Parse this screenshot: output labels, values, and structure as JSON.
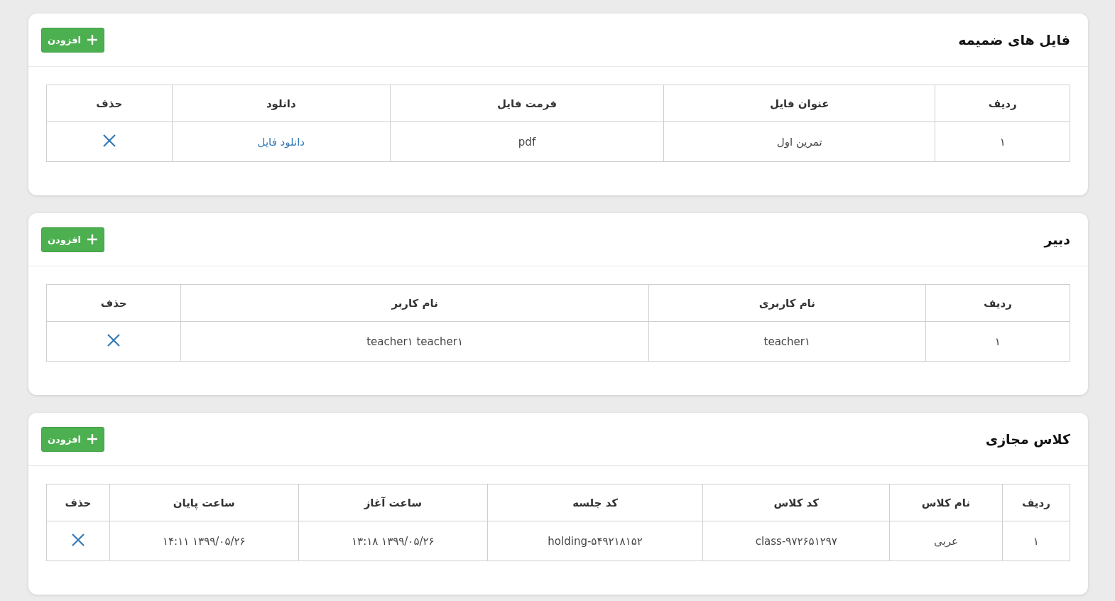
{
  "sections": [
    {
      "title": "فایل های ضمیمه",
      "add_button": "افزودن",
      "table": {
        "columns": [
          "ردیف",
          "عنوان فایل",
          "فرمت فایل",
          "دانلود",
          "حذف"
        ],
        "rows": [
          {
            "cells": [
              {
                "kind": "text",
                "text": "۱"
              },
              {
                "kind": "text",
                "text": "تمرین اول"
              },
              {
                "kind": "text",
                "text": "pdf"
              },
              {
                "kind": "link",
                "text": "دانلود فایل"
              },
              {
                "kind": "delete"
              }
            ]
          }
        ]
      }
    },
    {
      "title": "دبیر",
      "add_button": "افزودن",
      "table": {
        "columns": [
          "ردیف",
          "نام کاربری",
          "نام کاربر",
          "حذف"
        ],
        "rows": [
          {
            "cells": [
              {
                "kind": "text",
                "text": "۱"
              },
              {
                "kind": "text",
                "text": "teacher۱"
              },
              {
                "kind": "text",
                "text": "teacher۱ teacher۱"
              },
              {
                "kind": "delete"
              }
            ]
          }
        ]
      }
    },
    {
      "title": "کلاس مجازی",
      "add_button": "افزودن",
      "table": {
        "columns": [
          "ردیف",
          "نام کلاس",
          "کد کلاس",
          "کد جلسه",
          "ساعت آغاز",
          "ساعت پایان",
          "حذف"
        ],
        "rows": [
          {
            "cells": [
              {
                "kind": "text",
                "text": "۱"
              },
              {
                "kind": "text",
                "text": "عربی"
              },
              {
                "kind": "text",
                "text": "class-۹۷۲۶۵۱۲۹۷"
              },
              {
                "kind": "text",
                "text": "holding-۵۴۹۲۱۸۱۵۲"
              },
              {
                "kind": "text",
                "text": "۱۳۹۹/۰۵/۲۶ ۱۳:۱۸"
              },
              {
                "kind": "text",
                "text": "۱۳۹۹/۰۵/۲۶ ۱۴:۱۱"
              },
              {
                "kind": "delete"
              }
            ]
          }
        ]
      }
    }
  ]
}
